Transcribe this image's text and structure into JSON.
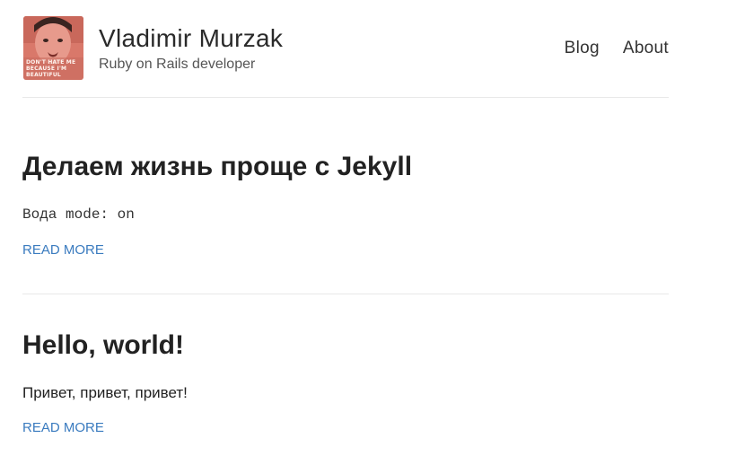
{
  "header": {
    "avatar": {
      "caption": "DON'T HATE ME BECAUSE I'M BEAUTIFUL",
      "colors": {
        "bg": "#d9786a",
        "face": "#e79a8c",
        "dark": "#3a2420"
      }
    },
    "title": "Vladimir Murzak",
    "subtitle": "Ruby on Rails developer",
    "nav": [
      {
        "label": "Blog"
      },
      {
        "label": "About"
      }
    ]
  },
  "posts": [
    {
      "title": "Делаем жизнь проще с Jekyll",
      "excerpt": "Вода mode: on",
      "read_more": "READ MORE"
    },
    {
      "title": "Hello, world!",
      "excerpt": "Привет, привет, привет!",
      "read_more": "READ MORE"
    }
  ],
  "colors": {
    "link": "#3a7bbf",
    "text": "#222222",
    "divider": "#e8e8e8"
  }
}
